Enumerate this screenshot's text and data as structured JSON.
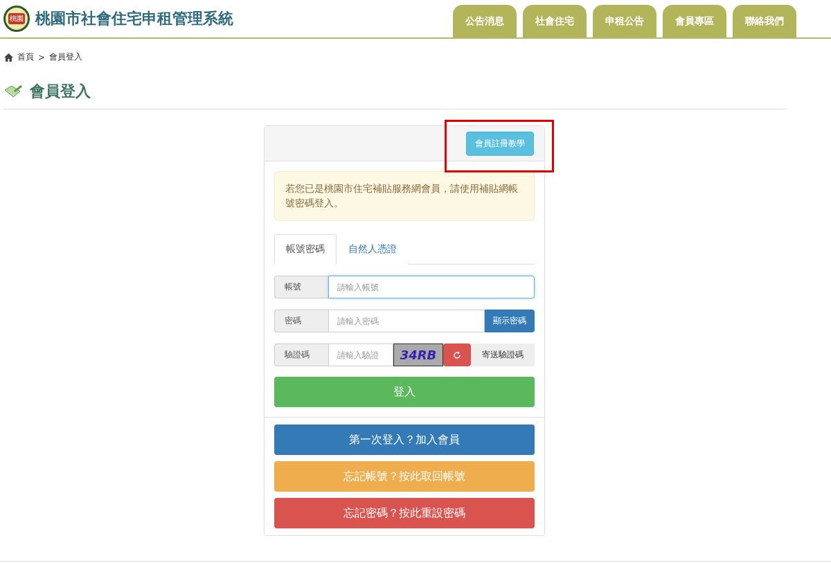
{
  "header": {
    "logo_text": "桃園",
    "title": "桃園市社會住宅申租管理系統"
  },
  "nav": [
    {
      "label": "公告消息"
    },
    {
      "label": "社會住宅"
    },
    {
      "label": "申租公告"
    },
    {
      "label": "會員專區"
    },
    {
      "label": "聯絡我們"
    }
  ],
  "breadcrumb": [
    {
      "label": "首頁"
    },
    {
      "label": ">"
    },
    {
      "label": "會員登入"
    }
  ],
  "page_title": "會員登入",
  "login_panel": {
    "tutorial_button": "會員註冊教學",
    "highlighted": true,
    "notice": "若您已是桃園市住宅補貼服務網會員，請使用補貼網帳號密碼登入。",
    "tabs": [
      {
        "label": "帳號密碼",
        "selected": true
      },
      {
        "label": "自然人憑證",
        "selected": false
      }
    ],
    "fields": [
      {
        "kind": "text",
        "label": "帳號",
        "placeholder": "請輸入帳號",
        "focused": true
      },
      {
        "kind": "password",
        "label": "密碼",
        "placeholder": "請輸入密碼",
        "focused": false,
        "action": "顯示密碼"
      },
      {
        "kind": "captcha",
        "label": "驗證碼",
        "placeholder": "請輸入驗證",
        "focused": false,
        "captcha": "34RB",
        "action": "寄送驗證碼"
      }
    ],
    "submit": "登入",
    "links": [
      {
        "label": "第一次登入？加入會員",
        "color": "#337ab7"
      },
      {
        "label": "忘記帳號？按此取回帳號",
        "color": "#f0ad4e"
      },
      {
        "label": "忘記密碼？按此重設密碼",
        "color": "#d9534f"
      }
    ]
  }
}
